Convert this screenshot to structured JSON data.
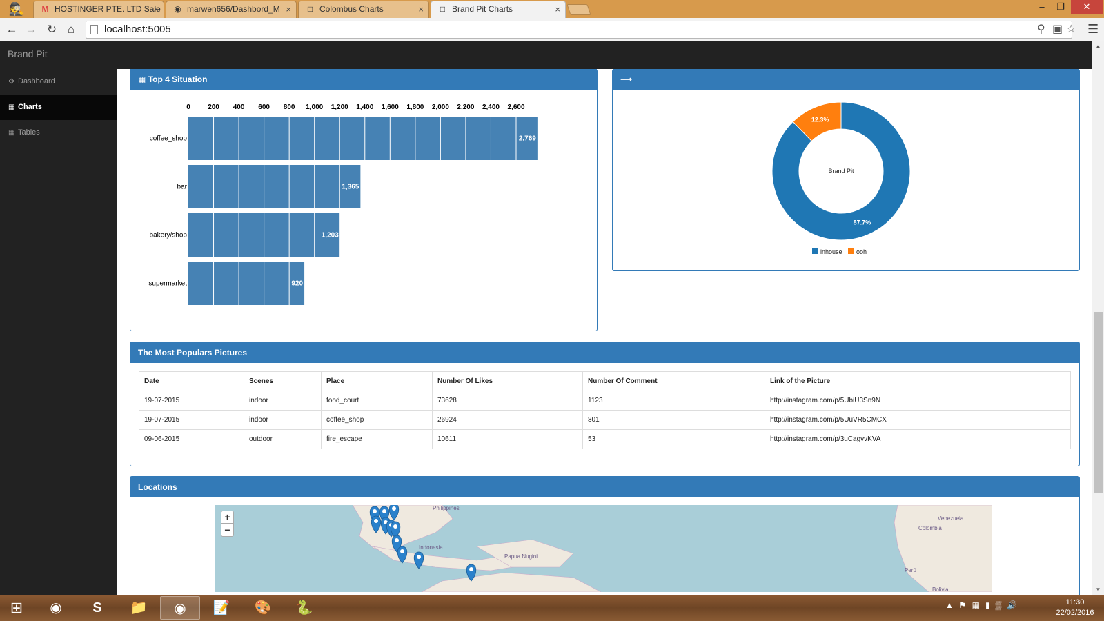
{
  "browser": {
    "tabs": [
      {
        "icon": "gmail-icon",
        "label": "HOSTINGER PTE. LTD Sale"
      },
      {
        "icon": "github-icon",
        "label": "marwen656/Dashbord_M"
      },
      {
        "icon": "page-icon",
        "label": "Colombus Charts"
      },
      {
        "icon": "page-icon",
        "label": "Brand Pit Charts"
      }
    ],
    "active_tab": 3,
    "url": "localhost:5005"
  },
  "app": {
    "brand": "Brand Pit",
    "sidebar": [
      {
        "icon": "dashboard-icon",
        "label": "Dashboard"
      },
      {
        "icon": "bar-chart-icon",
        "label": "Charts",
        "active": true
      },
      {
        "icon": "table-icon",
        "label": "Tables"
      }
    ]
  },
  "panels": {
    "bar_title": "Top 4 Situation",
    "donut_title": "",
    "table_title": "The Most Populars Pictures",
    "map_title": "Locations"
  },
  "chart_data": [
    {
      "type": "bar",
      "orientation": "horizontal",
      "title": "Top 4 Situation",
      "categories": [
        "coffee_shop",
        "bar",
        "bakery/shop",
        "supermarket"
      ],
      "values": [
        2769,
        1365,
        1203,
        920
      ],
      "value_labels": [
        "2,769",
        "1,365",
        "1,203",
        "920"
      ],
      "xlim": [
        0,
        2600
      ],
      "x_ticks": [
        "0",
        "200",
        "400",
        "600",
        "800",
        "1,000",
        "1,200",
        "1,400",
        "1,600",
        "1,800",
        "2,000",
        "2,200",
        "2,400",
        "2,600"
      ],
      "grid": true,
      "color": "#4682b4"
    },
    {
      "type": "pie",
      "center_label": "Brand Pit",
      "series": [
        {
          "name": "inhouse",
          "value": 87.7,
          "label": "87.7%",
          "color": "#1f77b4"
        },
        {
          "name": "ooh",
          "value": 12.3,
          "label": "12.3%",
          "color": "#ff7f0e"
        }
      ],
      "legend": "bottom"
    }
  ],
  "table": {
    "headers": [
      "Date",
      "Scenes",
      "Place",
      "Number Of Likes",
      "Number Of Comment",
      "Link of the Picture"
    ],
    "rows": [
      [
        "19-07-2015",
        "indoor",
        "food_court",
        "73628",
        "1123",
        "http://instagram.com/p/5UbiU3Sn9N"
      ],
      [
        "19-07-2015",
        "indoor",
        "coffee_shop",
        "26924",
        "801",
        "http://instagram.com/p/5UuVR5CMCX"
      ],
      [
        "09-06-2015",
        "outdoor",
        "fire_escape",
        "10611",
        "53",
        "http://instagram.com/p/3uCagvvKVA"
      ]
    ]
  },
  "map": {
    "zoom_in": "+",
    "zoom_out": "−",
    "labels": [
      "Philippines",
      "Indonesia",
      "Papua Nugini",
      "Venezuela",
      "Colombia",
      "Perú",
      "Bolivia"
    ],
    "marker_color": "#2a81cb"
  },
  "taskbar": {
    "apps": [
      "internet-explorer-icon",
      "chrome-icon",
      "skype-icon",
      "file-explorer-icon",
      "chrome-icon",
      "notepad-icon",
      "paint-icon",
      "python-icon"
    ],
    "time": "11:30",
    "date": "22/02/2016"
  }
}
